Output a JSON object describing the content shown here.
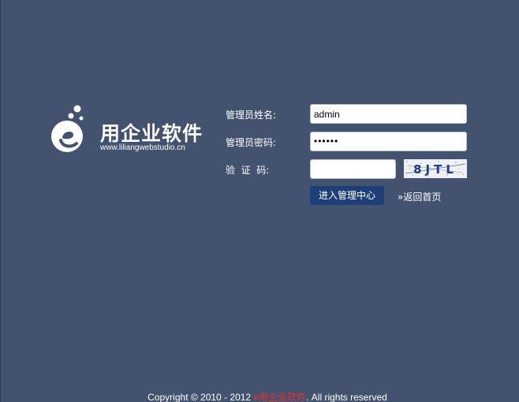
{
  "logo": {
    "icon": "e-bubble-logo-icon",
    "name": "用企业软件",
    "url": "www.liliangwebstudio.cn"
  },
  "form": {
    "username_label": "管理员姓名:",
    "username_value": "admin",
    "password_label": "管理员密码:",
    "password_value": "••••••",
    "captcha_label": "验  证  码:",
    "captcha_value": "",
    "captcha_text": "8JTL",
    "submit_label": "进入管理中心",
    "home_link": "»返回首页"
  },
  "footer": {
    "prefix": "Copyright © 2010 - 2012 ",
    "brand": "e用企业软件",
    "suffix": ". All rights reserved"
  },
  "colors": {
    "background": "#42526f",
    "button": "#1e3f78",
    "brand_red": "#e8312f"
  }
}
